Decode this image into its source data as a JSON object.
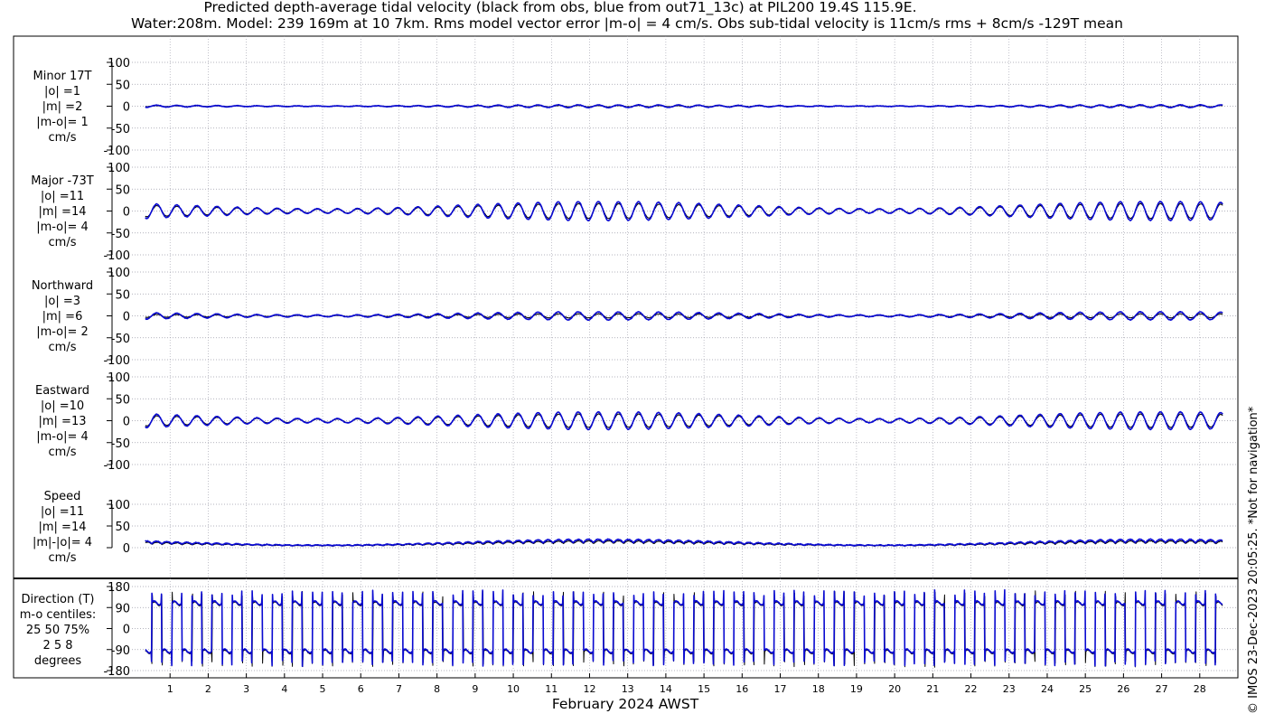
{
  "title_line1": "Predicted depth-average tidal velocity (black from obs, blue from out71_13c) at PIL200 19.4S 115.9E.",
  "title_line2": "Water:208m. Model: 239 169m at 10 7km. Rms model vector error |m-o| = 4 cm/s. Obs sub-tidal velocity is 11cm/s rms + 8cm/s -129T mean",
  "copyright": "© IMOS 23-Dec-2023 20:05:25. *Not for navigation*",
  "colors": {
    "obs": "#000000",
    "model": "#0a0ad2",
    "grid": "#9a9aa8"
  },
  "chart_data": {
    "type": "line",
    "xlabel": "February 2024 AWST",
    "x_ticks": [
      "1",
      "2",
      "3",
      "4",
      "5",
      "6",
      "7",
      "8",
      "9",
      "10",
      "11",
      "12",
      "13",
      "14",
      "15",
      "16",
      "17",
      "18",
      "19",
      "20",
      "21",
      "22",
      "23",
      "24",
      "25",
      "26",
      "27",
      "28"
    ],
    "xlim_days": [
      0,
      29
    ],
    "series_names": [
      "obs",
      "model"
    ],
    "panels": [
      {
        "name": "minor",
        "label": [
          "Minor 17T",
          "|o| =1",
          "|m| =2",
          "|m-o|= 1",
          "cm/s"
        ],
        "ylim": [
          -100,
          100
        ],
        "yticks": [
          100,
          50,
          0,
          -50,
          -100
        ],
        "amp_obs": 1,
        "amp_model": 2
      },
      {
        "name": "major",
        "label": [
          "Major -73T",
          "|o| =11",
          "|m| =14",
          "|m-o|= 4",
          "cm/s"
        ],
        "ylim": [
          -100,
          100
        ],
        "yticks": [
          100,
          50,
          0,
          -50,
          -100
        ],
        "amp_obs": 11,
        "amp_model": 14
      },
      {
        "name": "northward",
        "label": [
          "Northward",
          "|o| =3",
          "|m| =6",
          "|m-o|= 2",
          "cm/s"
        ],
        "ylim": [
          -100,
          100
        ],
        "yticks": [
          100,
          50,
          0,
          -50,
          -100
        ],
        "amp_obs": 3,
        "amp_model": 6
      },
      {
        "name": "eastward",
        "label": [
          "Eastward",
          "|o| =10",
          "|m| =13",
          "|m-o|= 4",
          "cm/s"
        ],
        "ylim": [
          -100,
          100
        ],
        "yticks": [
          100,
          50,
          0,
          -50,
          -100
        ],
        "amp_obs": 10,
        "amp_model": 13
      },
      {
        "name": "speed",
        "label": [
          "Speed",
          "|o| =11",
          "|m| =14",
          "|m|-|o|= 4",
          "cm/s"
        ],
        "ylim": [
          0,
          100
        ],
        "yticks": [
          100,
          50,
          0
        ],
        "amp_obs": 11,
        "amp_model": 14
      },
      {
        "name": "direction",
        "label": [
          "Direction (T)",
          "m-o centiles:",
          "25  50  75%",
          "2   5   8",
          "degrees"
        ],
        "ylim": [
          -180,
          180
        ],
        "yticks": [
          180,
          90,
          0,
          -90,
          -180
        ]
      }
    ]
  }
}
